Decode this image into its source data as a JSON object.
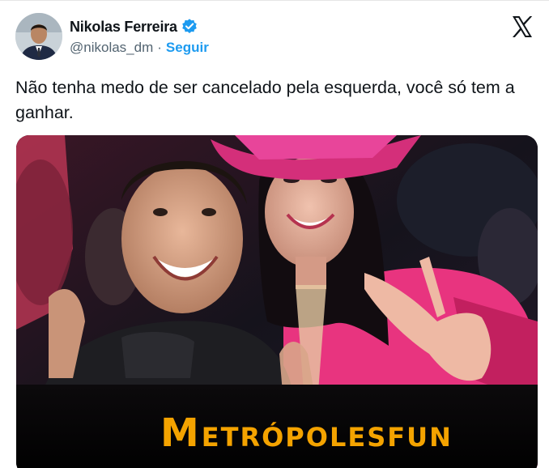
{
  "author": {
    "display_name": "Nikolas Ferreira",
    "handle": "@nikolas_dm",
    "separator": "·",
    "follow_label": "Seguir",
    "verified": true,
    "verified_color": "#1d9bf0"
  },
  "tweet": {
    "text": "Não tenha medo de ser cancelado pela esquerda, você só tem a ganhar."
  },
  "media": {
    "watermark_initial": "M",
    "watermark_main": "ETRÓPOLES",
    "watermark_suffix": "FUN",
    "watermark_color": "#f4a300"
  },
  "icons": {
    "platform": "x-logo-icon",
    "verified": "verified-badge-icon"
  }
}
